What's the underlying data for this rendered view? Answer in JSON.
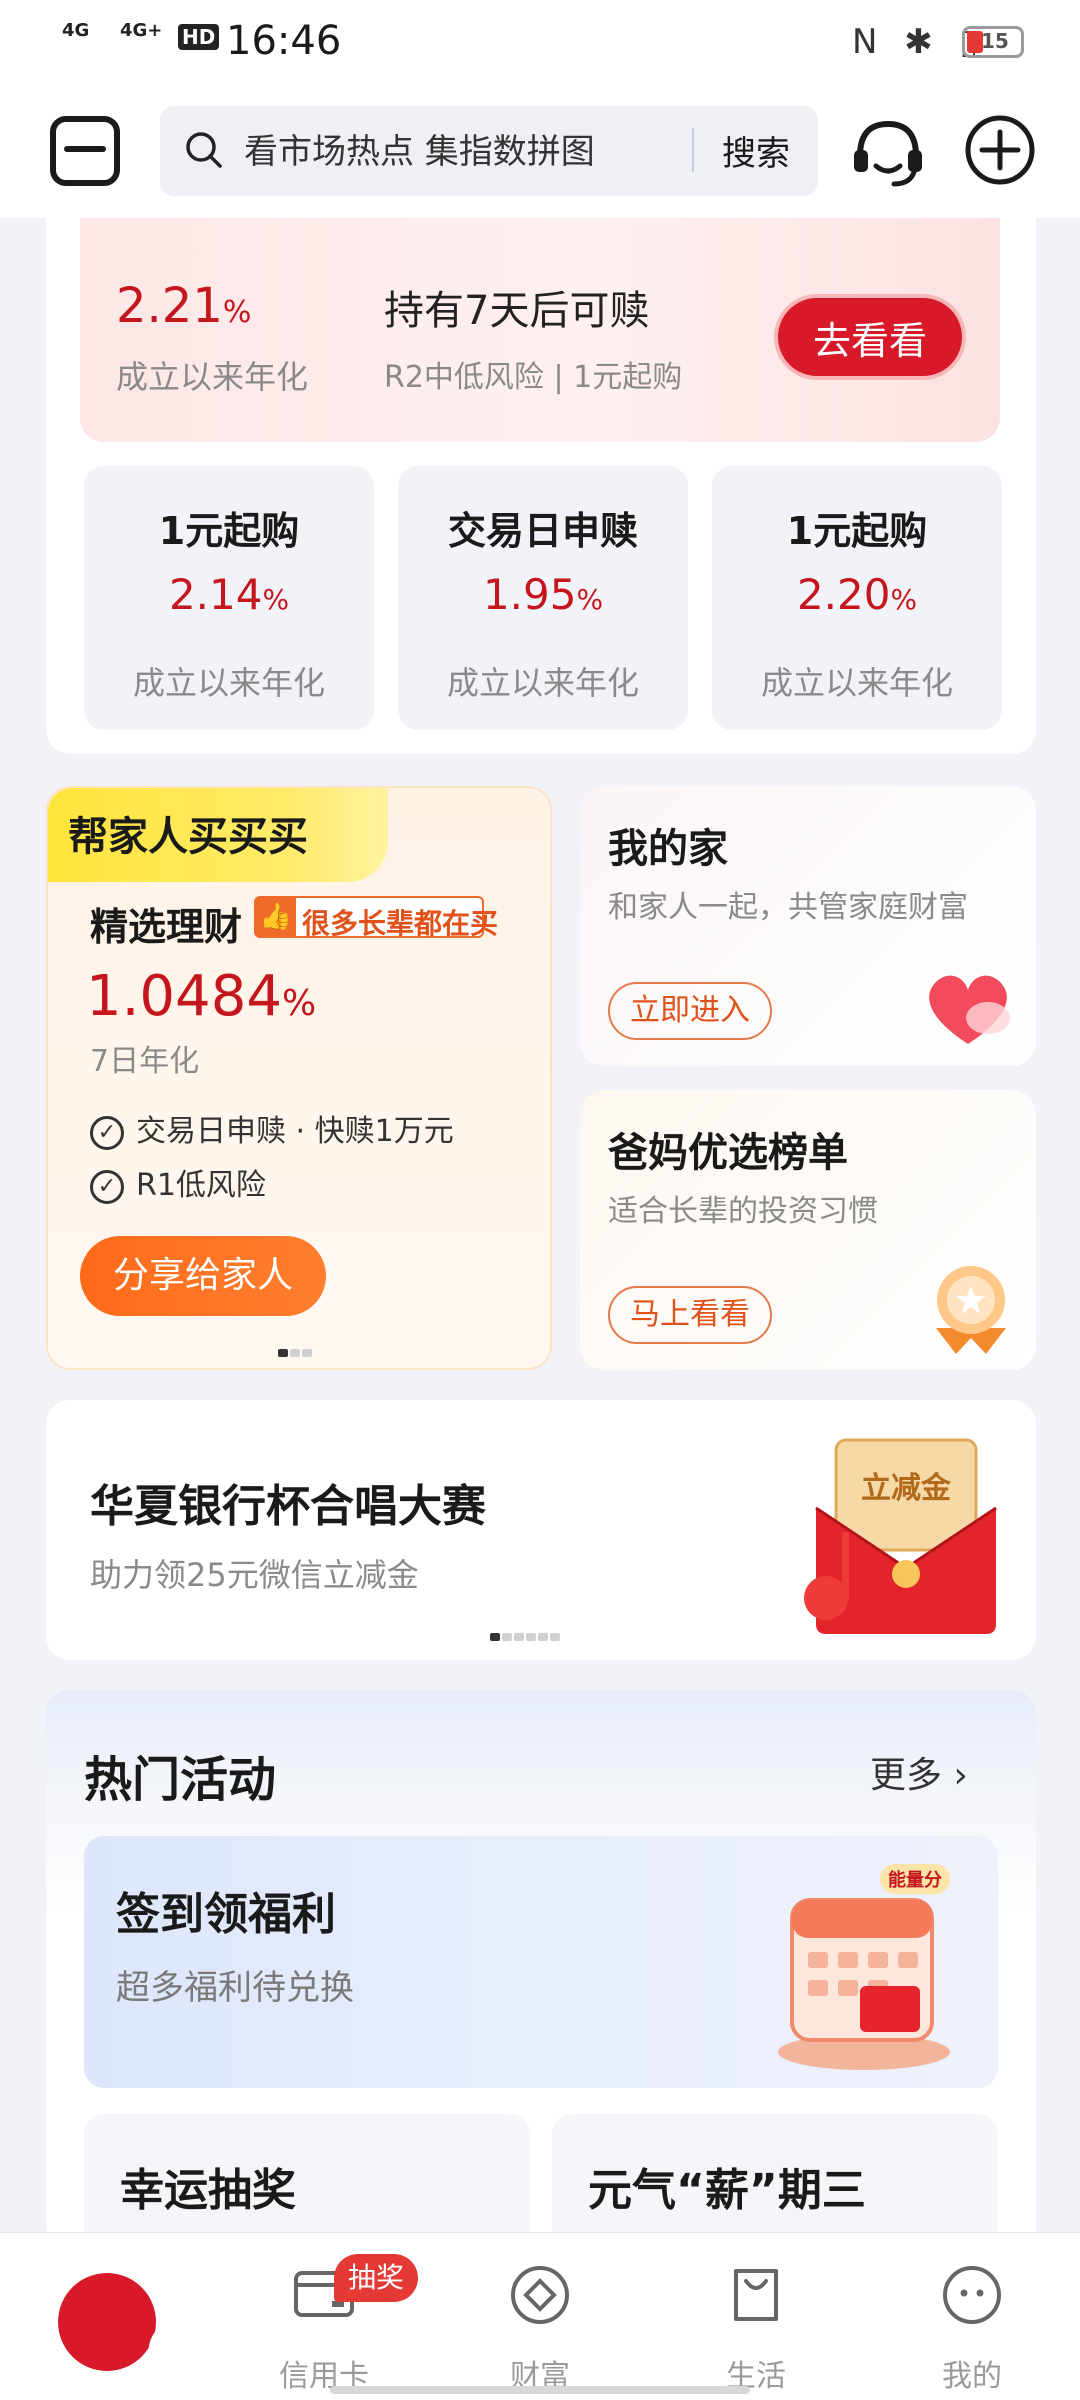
{
  "status_bar": {
    "network1": "4G",
    "network2": "4G+",
    "hd": "HD",
    "time": "16:46",
    "battery": "15"
  },
  "header": {
    "search_placeholder": "看市场热点 集指数拼图",
    "search_button": "搜索",
    "icons": [
      "menu-icon",
      "search-icon",
      "customer-service-icon",
      "add-icon"
    ]
  },
  "featured_product": {
    "rate": "2.21",
    "rate_unit": "%",
    "rate_label": "成立以来年化",
    "hold_text": "持有7天后可赎",
    "risk_text": "R2中低风险 | 1元起购",
    "button": "去看看"
  },
  "mini_products": [
    {
      "title": "1元起购",
      "rate": "2.14",
      "unit": "%",
      "label": "成立以来年化"
    },
    {
      "title": "交易日申赎",
      "rate": "1.95",
      "unit": "%",
      "label": "成立以来年化"
    },
    {
      "title": "1元起购",
      "rate": "2.20",
      "unit": "%",
      "label": "成立以来年化"
    }
  ],
  "family": {
    "tag": "帮家人买买买",
    "title": "精选理财",
    "badge": "很多长辈都在买",
    "rate": "1.0484",
    "rate_unit": "%",
    "rate_label": "7日年化",
    "features": [
      "交易日申赎 · 快赎1万元",
      "R1低风险"
    ],
    "share_button": "分享给家人"
  },
  "my_home": {
    "title": "我的家",
    "subtitle": "和家人一起，共管家庭财富",
    "button": "立即进入"
  },
  "parents_list": {
    "title": "爸妈优选榜单",
    "subtitle": "适合长辈的投资习惯",
    "button": "马上看看"
  },
  "choir_banner": {
    "title": "华夏银行杯合唱大赛",
    "subtitle": "助力领25元微信立减金",
    "envelope_text": "立减金"
  },
  "hot_activities": {
    "title": "热门活动",
    "more": "更多",
    "checkin_title": "签到领福利",
    "checkin_subtitle": "超多福利待兑换",
    "checkin_tag": "能量分",
    "lucky_draw": "幸运抽奖",
    "wednesday": "元气“薪”期三"
  },
  "bottom_nav": {
    "credit_card": "信用卡",
    "wealth": "财富",
    "life": "生活",
    "mine": "我的",
    "lottery_badge": "抽奖"
  },
  "colors": {
    "accent_red": "#c4161c",
    "button_red": "#d7192a",
    "orange": "#ff6a1a"
  }
}
